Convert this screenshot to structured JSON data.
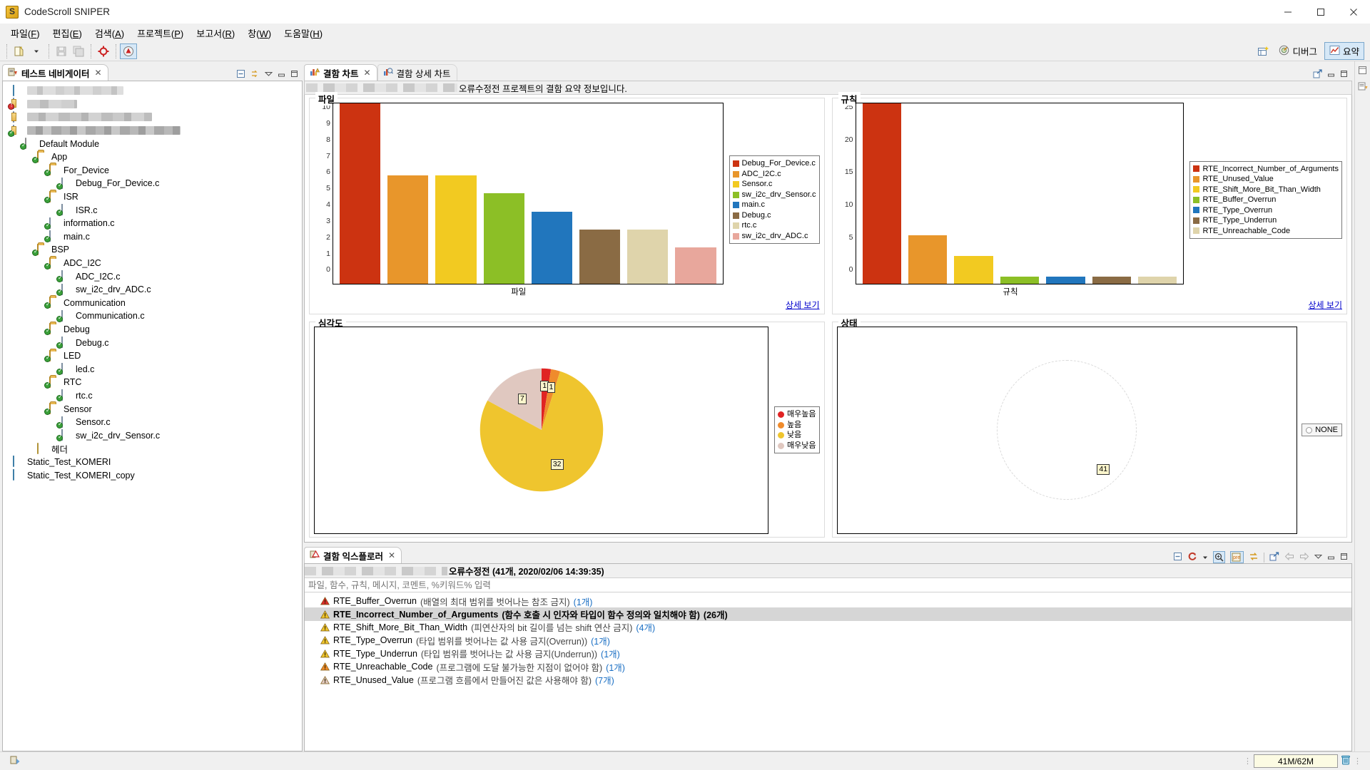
{
  "window": {
    "title": "CodeScroll SNIPER",
    "app_icon": "codescroll-logo-icon",
    "minimize": "—",
    "maximize": "☐",
    "close": "✕"
  },
  "menubar": {
    "items": [
      {
        "label": "파일(F)",
        "name": "menu-file"
      },
      {
        "label": "편집(E)",
        "name": "menu-edit"
      },
      {
        "label": "검색(A)",
        "name": "menu-search"
      },
      {
        "label": "프로젝트(P)",
        "name": "menu-project"
      },
      {
        "label": "보고서(R)",
        "name": "menu-report"
      },
      {
        "label": "창(W)",
        "name": "menu-window"
      },
      {
        "label": "도움말(H)",
        "name": "menu-help"
      }
    ]
  },
  "toolbar": {
    "icons": [
      "new-icon",
      "dropdown-arrow-icon",
      "save-icon",
      "save-all-icon",
      "target-icon",
      "analyze-icon"
    ],
    "perspectives": [
      {
        "label": "디버그",
        "icon": "debug-perspective-icon",
        "selected": false
      },
      {
        "label": "요약",
        "icon": "summary-perspective-icon",
        "selected": true
      }
    ],
    "new_perspective_icon": "new-perspective-icon"
  },
  "navigator": {
    "tab_label": "테스트 네비게이터",
    "tab_icon": "test-navigator-icon",
    "close_icon": "✕",
    "view_tools": [
      "collapse-all-icon",
      "link-editor-icon",
      "view-menu-icon",
      "minimize-icon",
      "maximize-icon"
    ],
    "tree": [
      {
        "label": "",
        "indent": 0,
        "icon": "bin-icon",
        "blur": "b1",
        "blurw": 135
      },
      {
        "label": "",
        "indent": 0,
        "icon": "project-error-icon",
        "blur": "b2",
        "blurw": 70
      },
      {
        "label": "",
        "indent": 0,
        "icon": "project-icon",
        "blur": "b3",
        "blurw": 175
      },
      {
        "label": "",
        "indent": 0,
        "icon": "project-ok-icon",
        "blur": "b4",
        "blurw": 215
      },
      {
        "label": "Default Module",
        "indent": 1,
        "icon": "module-icon"
      },
      {
        "label": "App",
        "indent": 2,
        "icon": "folder-icon"
      },
      {
        "label": "For_Device",
        "indent": 3,
        "icon": "folder-icon"
      },
      {
        "label": "Debug_For_Device.c",
        "indent": 4,
        "icon": "c-file-icon"
      },
      {
        "label": "ISR",
        "indent": 3,
        "icon": "folder-icon"
      },
      {
        "label": "ISR.c",
        "indent": 4,
        "icon": "c-file-icon"
      },
      {
        "label": "information.c",
        "indent": 3,
        "icon": "c-file-icon"
      },
      {
        "label": "main.c",
        "indent": 3,
        "icon": "c-file-icon"
      },
      {
        "label": "BSP",
        "indent": 2,
        "icon": "folder-icon"
      },
      {
        "label": "ADC_I2C",
        "indent": 3,
        "icon": "folder-icon"
      },
      {
        "label": "ADC_I2C.c",
        "indent": 4,
        "icon": "c-file-icon"
      },
      {
        "label": "sw_i2c_drv_ADC.c",
        "indent": 4,
        "icon": "c-file-icon"
      },
      {
        "label": "Communication",
        "indent": 3,
        "icon": "folder-icon"
      },
      {
        "label": "Communication.c",
        "indent": 4,
        "icon": "c-file-icon"
      },
      {
        "label": "Debug",
        "indent": 3,
        "icon": "folder-icon"
      },
      {
        "label": "Debug.c",
        "indent": 4,
        "icon": "c-file-icon"
      },
      {
        "label": "LED",
        "indent": 3,
        "icon": "folder-icon"
      },
      {
        "label": "led.c",
        "indent": 4,
        "icon": "c-file-icon"
      },
      {
        "label": "RTC",
        "indent": 3,
        "icon": "folder-icon"
      },
      {
        "label": "rtc.c",
        "indent": 4,
        "icon": "c-file-icon"
      },
      {
        "label": "Sensor",
        "indent": 3,
        "icon": "folder-icon"
      },
      {
        "label": "Sensor.c",
        "indent": 4,
        "icon": "c-file-icon"
      },
      {
        "label": "sw_i2c_drv_Sensor.c",
        "indent": 4,
        "icon": "c-file-icon"
      },
      {
        "label": "헤더",
        "indent": 2,
        "icon": "header-icon"
      },
      {
        "label": "Static_Test_KOMERI",
        "indent": 0,
        "icon": "bin-icon"
      },
      {
        "label": "Static_Test_KOMERI_copy",
        "indent": 0,
        "icon": "bin-icon"
      }
    ]
  },
  "charts_view": {
    "tabs": [
      {
        "label": "결함 차트",
        "icon": "defect-chart-icon",
        "active": true,
        "closable": true
      },
      {
        "label": "결함 상세 차트",
        "icon": "defect-detail-chart-icon",
        "active": false,
        "closable": false
      }
    ],
    "header_text": "오류수정전 프로젝트의 결함 요약 정보입니다.",
    "view_tools": [
      "export-icon",
      "minimize-icon",
      "maximize-icon"
    ],
    "detail_link": "상세 보기",
    "groups": {
      "file": "파일",
      "rule": "규칙",
      "severity": "심각도",
      "status": "상태"
    },
    "status_none_label": "NONE"
  },
  "chart_data": [
    {
      "type": "bar",
      "title": "파일",
      "xlabel": "파일",
      "ylabel": "",
      "ylim": [
        0,
        10
      ],
      "yticks": [
        10,
        9,
        8,
        7,
        6,
        5,
        4,
        3,
        2,
        1,
        0
      ],
      "grid": false,
      "legend_position": "right",
      "categories": [
        "Debug_For_Device.c",
        "ADC_I2C.c",
        "Sensor.c",
        "sw_i2c_drv_Sensor.c",
        "main.c",
        "Debug.c",
        "rtc.c",
        "sw_i2c_drv_ADC.c"
      ],
      "values": [
        10,
        6,
        6,
        5,
        4,
        3,
        3,
        2
      ],
      "colors": [
        "#cc3311",
        "#e8962b",
        "#f2ca21",
        "#8cbf26",
        "#2176bd",
        "#8a6b44",
        "#dfd4ab",
        "#e8a79c"
      ]
    },
    {
      "type": "bar",
      "title": "규칙",
      "xlabel": "규칙",
      "ylabel": "",
      "ylim": [
        0,
        26
      ],
      "yticks": [
        25,
        20,
        15,
        10,
        5,
        0
      ],
      "grid": false,
      "legend_position": "right",
      "categories": [
        "RTE_Incorrect_Number_of_Arguments",
        "RTE_Unused_Value",
        "RTE_Shift_More_Bit_Than_Width",
        "RTE_Buffer_Overrun",
        "RTE_Type_Overrun",
        "RTE_Type_Underrun",
        "RTE_Unreachable_Code"
      ],
      "values": [
        26,
        7,
        4,
        1,
        1,
        1,
        1
      ],
      "colors": [
        "#cc3311",
        "#e8962b",
        "#f2ca21",
        "#8cbf26",
        "#2176bd",
        "#8a6b44",
        "#dfd4ab"
      ]
    },
    {
      "type": "pie",
      "title": "심각도",
      "legend_position": "right",
      "categories": [
        "매우높음",
        "높음",
        "낮음",
        "매우낮음"
      ],
      "values": [
        1,
        1,
        32,
        7
      ],
      "labels": [
        "1",
        "1",
        "32",
        "7"
      ],
      "colors": [
        "#e02323",
        "#ef8b2c",
        "#efc52e",
        "#e0c8c0"
      ]
    },
    {
      "type": "pie",
      "title": "상태",
      "legend_position": "right",
      "categories": [
        "NONE"
      ],
      "values": [
        41
      ],
      "labels": [
        "41"
      ],
      "colors": [
        "#ffffff"
      ]
    }
  ],
  "explorer": {
    "tab_label": "결함 익스플로러",
    "tab_icon": "defect-explorer-icon",
    "close_icon": "✕",
    "header_text": "오류수정전 (41개, 2020/02/06 14:39:35)",
    "filter_placeholder": "파일, 함수, 규칙, 메시지, 코멘트, %키워드% 입력",
    "filter_value": "",
    "view_tools": [
      "collapse-all-icon",
      "refresh-icon",
      "dropdown-arrow-icon",
      "zoom-icon",
      "pre-icon",
      "sync-icon",
      "open-external-icon",
      "back-arrow-icon",
      "forward-arrow-icon",
      "view-menu-icon",
      "minimize-icon",
      "maximize-icon"
    ],
    "items": [
      {
        "name": "RTE_Buffer_Overrun",
        "desc": "(배열의 최대 범위를 벗어나는 참조 금지)",
        "count": "(1개)",
        "severity_color": "#d92b2b",
        "selected": false
      },
      {
        "name": "RTE_Incorrect_Number_of_Arguments",
        "desc": "(함수 호출 시 인자와 타입이 함수 정의와 일치해야 함)",
        "count": "(26개)",
        "severity_color": "#efc52e",
        "selected": true
      },
      {
        "name": "RTE_Shift_More_Bit_Than_Width",
        "desc": "(피연산자의 bit 길이를 넘는 shift 연산 금지)",
        "count": "(4개)",
        "severity_color": "#efc52e",
        "selected": false
      },
      {
        "name": "RTE_Type_Overrun",
        "desc": "(타입 범위를 벗어나는 값 사용 금지(Overrun))",
        "count": "(1개)",
        "severity_color": "#efc52e",
        "selected": false
      },
      {
        "name": "RTE_Type_Underrun",
        "desc": "(타입 범위를 벗어나는 값 사용 금지(Underrun))",
        "count": "(1개)",
        "severity_color": "#efc52e",
        "selected": false
      },
      {
        "name": "RTE_Unreachable_Code",
        "desc": "(프로그램에 도달 불가능한 지점이 없어야 함)",
        "count": "(1개)",
        "severity_color": "#ef8b2c",
        "selected": false
      },
      {
        "name": "RTE_Unused_Value",
        "desc": "(프로그램 흐름에서 만들어진 값은 사용해야 함)",
        "count": "(7개)",
        "severity_color": "#e0c8c0",
        "selected": false
      }
    ]
  },
  "statusbar": {
    "left_icon": "status-indicator-icon",
    "heap_value": "41M/62M",
    "trash_icon": "trash-icon"
  }
}
